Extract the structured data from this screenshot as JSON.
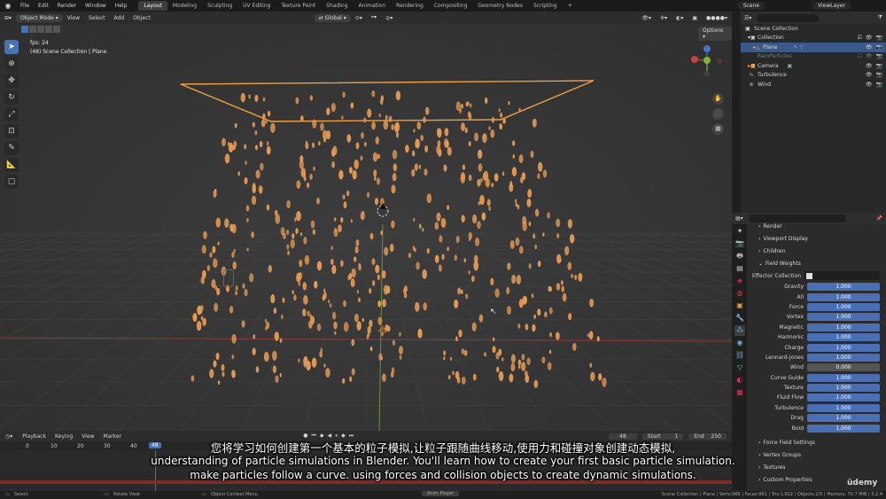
{
  "topbar": {
    "menus": [
      "File",
      "Edit",
      "Render",
      "Window",
      "Help"
    ],
    "workspaces": [
      "Layout",
      "Modeling",
      "Sculpting",
      "UV Editing",
      "Texture Paint",
      "Shading",
      "Animation",
      "Rendering",
      "Compositing",
      "Geometry Nodes",
      "Scripting"
    ],
    "active_workspace": "Layout",
    "add_tab": "+",
    "scene": "Scene",
    "view_layer": "ViewLayer"
  },
  "viewport": {
    "mode": "Object Mode",
    "menus": [
      "View",
      "Select",
      "Add",
      "Object"
    ],
    "transform_orientation": "Global",
    "options_label": "Options",
    "overlay_fps": "fps: 24",
    "overlay_collection": "(48) Scene Collection | Plane"
  },
  "outliner": {
    "rows": [
      {
        "label": "Scene Collection",
        "icon": "▣"
      },
      {
        "label": "Collection",
        "icon": "▸"
      },
      {
        "label": "Plane",
        "icon": "△"
      },
      {
        "label": "RainParticles",
        "icon": "·"
      },
      {
        "label": "Camera",
        "icon": "■"
      },
      {
        "label": "Turbulence",
        "icon": "∿"
      },
      {
        "label": "Wind",
        "icon": "≋"
      }
    ]
  },
  "properties": {
    "sections_top": [
      "Render",
      "Viewport Display",
      "Children"
    ],
    "field_weights_title": "Field Weights",
    "effector_collection_label": "Effector Collection",
    "weights": [
      {
        "label": "Gravity",
        "value": "1.000"
      },
      {
        "label": "All",
        "value": "1.000"
      },
      {
        "label": "Force",
        "value": "1.000"
      },
      {
        "label": "Vortex",
        "value": "1.000"
      },
      {
        "label": "Magnetic",
        "value": "1.000"
      },
      {
        "label": "Harmonic",
        "value": "1.000"
      },
      {
        "label": "Charge",
        "value": "1.000"
      },
      {
        "label": "Lennard-Jones",
        "value": "1.000"
      },
      {
        "label": "Wind",
        "value": "0.000"
      },
      {
        "label": "Curve Guide",
        "value": "1.000"
      },
      {
        "label": "Texture",
        "value": "1.000"
      },
      {
        "label": "Fluid Flow",
        "value": "1.000"
      },
      {
        "label": "Turbulence",
        "value": "1.000"
      },
      {
        "label": "Drag",
        "value": "1.000"
      },
      {
        "label": "Boid",
        "value": "1.000"
      }
    ],
    "sections_bottom": [
      "Force Field Settings",
      "Vertex Groups",
      "Textures",
      "Custom Properties"
    ]
  },
  "timeline": {
    "menus": [
      "Playback",
      "Keying",
      "View",
      "Marker"
    ],
    "current_frame": "48",
    "start_label": "Start",
    "start_value": "1",
    "end_label": "End",
    "end_value": "250",
    "ruler": [
      "0",
      "10",
      "20",
      "30",
      "40",
      "48"
    ]
  },
  "statusbar": {
    "select": "Select",
    "rotate": "Rotate View",
    "context": "Object Context Menu",
    "anim_player": "Anim Player",
    "stats": "Scene Collection | Plane | Verts:966 | Faces:961 | Tris:1,922 | Objects:2/5 | Memory: 70.7 MiB | 3.2.4"
  },
  "watermark": "ūdemy",
  "subtitles": {
    "zh": "您将学习如何创建第一个基本的粒子模拟,让粒子跟随曲线移动,使用力和碰撞对象创建动态模拟,",
    "en1": "understanding of particle simulations in Blender. You'll learn how to create your first basic particle simulation.",
    "en2": "make particles follow a curve. using forces and collision objects to create dynamic simulations."
  },
  "colors": {
    "particle": "#e59a55",
    "selection": "#f5a030",
    "accent": "#4772b3"
  }
}
